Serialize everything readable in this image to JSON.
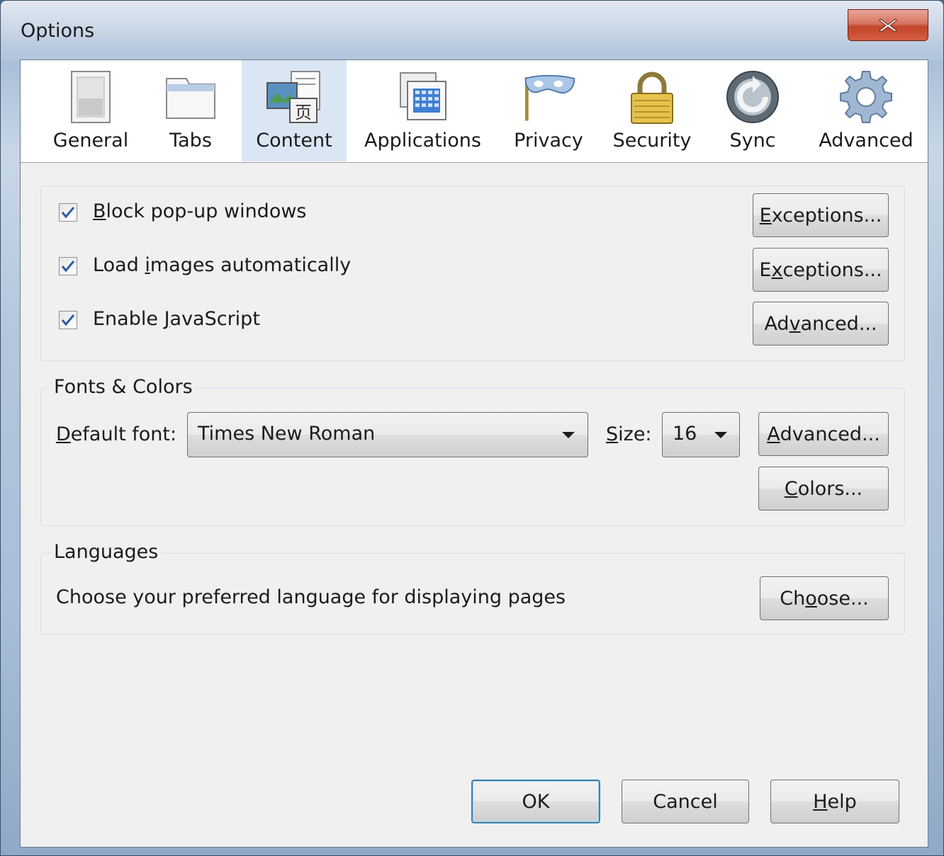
{
  "window": {
    "title": "Options",
    "close_icon": "close-x-icon"
  },
  "tabs": [
    {
      "label": "General",
      "icon": "general-switch-icon",
      "selected": false
    },
    {
      "label": "Tabs",
      "icon": "tabs-folder-icon",
      "selected": false
    },
    {
      "label": "Content",
      "icon": "content-page-icon",
      "selected": true
    },
    {
      "label": "Applications",
      "icon": "applications-window-icon",
      "selected": false
    },
    {
      "label": "Privacy",
      "icon": "privacy-mask-icon",
      "selected": false
    },
    {
      "label": "Security",
      "icon": "security-padlock-icon",
      "selected": false
    },
    {
      "label": "Sync",
      "icon": "sync-arrows-icon",
      "selected": false
    },
    {
      "label": "Advanced",
      "icon": "advanced-gear-icon",
      "selected": false
    }
  ],
  "content": {
    "block_popups": {
      "pre": "",
      "accel": "B",
      "post": "lock pop-up windows",
      "checked": true,
      "button": {
        "pre": "",
        "accel": "E",
        "post": "xceptions..."
      }
    },
    "load_images": {
      "pre": "Load ",
      "accel": "i",
      "post": "mages automatically",
      "checked": true,
      "button": {
        "pre": "E",
        "accel": "x",
        "post": "ceptions..."
      }
    },
    "javascript": {
      "pre": "Enable ",
      "accel": "J",
      "post": "avaScript",
      "checked": true,
      "button": {
        "pre": "Ad",
        "accel": "v",
        "post": "anced..."
      }
    }
  },
  "fonts": {
    "caption": "Fonts & Colors",
    "default_font_label": {
      "accel": "D",
      "post": "efault font:"
    },
    "default_font_value": "Times New Roman",
    "size_label": {
      "accel": "S",
      "post": "ize:"
    },
    "size_value": "16",
    "advanced_button": {
      "accel": "A",
      "post": "dvanced..."
    },
    "colors_button": {
      "accel": "C",
      "post": "olors..."
    }
  },
  "languages": {
    "caption": "Languages",
    "description": "Choose your preferred language for displaying pages",
    "choose_button": {
      "pre": "Ch",
      "accel": "o",
      "post": "ose..."
    }
  },
  "footer": {
    "ok": "OK",
    "cancel": "Cancel",
    "help": {
      "accel": "H",
      "post": "elp"
    }
  },
  "colors": {
    "selected_tab_bg": "#dbe6f4",
    "checkbox_check": "#2e5e9f",
    "default_button_border": "#3c7fb1"
  }
}
